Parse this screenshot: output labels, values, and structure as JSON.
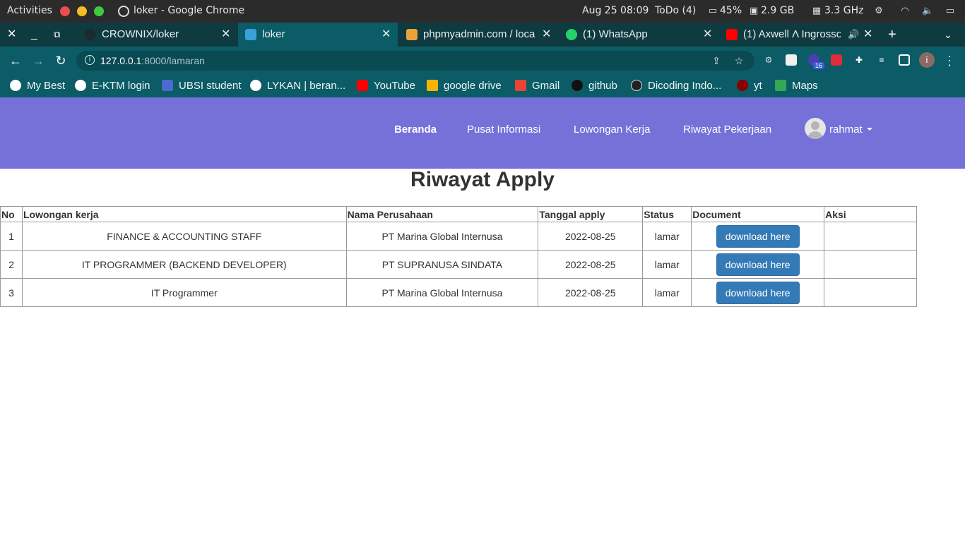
{
  "os_bar": {
    "activities": "Activities",
    "window_title": "loker - Google Chrome",
    "clock": "Aug 25  08:09",
    "todo": "ToDo (4)",
    "cpu": "45%",
    "memory": "2.9 GB",
    "frequency": "3.3 GHz"
  },
  "tabs": [
    {
      "label": "CROWNIX/loker",
      "icon": "github-icon",
      "active": false
    },
    {
      "label": "loker",
      "icon": "site-favicon",
      "active": true
    },
    {
      "label": "phpmyadmin.com / loca",
      "icon": "phpmyadmin-icon",
      "active": false
    },
    {
      "label": "(1) WhatsApp",
      "icon": "whatsapp-icon",
      "active": false
    },
    {
      "label": "(1) Axwell Λ Ingrosso",
      "icon": "youtube-icon",
      "active": false
    }
  ],
  "address": {
    "host": "127.0.0.1",
    "path": ":8000/lamaran"
  },
  "extensions": {
    "badge": "16"
  },
  "profile_initial": "i",
  "bookmarks": [
    {
      "label": "My Best",
      "color": "#ffffff"
    },
    {
      "label": "E-KTM login",
      "color": "#ffffff"
    },
    {
      "label": "UBSI student",
      "color": "#4a6bd1"
    },
    {
      "label": "LYKAN | beran...",
      "color": "#ffffff"
    },
    {
      "label": "YouTube",
      "color": "#ff0000"
    },
    {
      "label": "google drive",
      "color": "#f4b400"
    },
    {
      "label": "Gmail",
      "color": "#ea4335"
    },
    {
      "label": "github",
      "color": "#111111"
    },
    {
      "label": "Dicoding Indo...",
      "color": "#222222"
    },
    {
      "label": "yt",
      "color": "#8b0000"
    },
    {
      "label": "Maps",
      "color": "#34a853"
    }
  ],
  "navbar": {
    "links": [
      "Beranda",
      "Pusat Informasi",
      "Lowongan Kerja",
      "Riwayat Pekerjaan"
    ],
    "user": "rahmat",
    "bg": "#7571d9"
  },
  "page": {
    "title": "Riwayat Apply",
    "columns": [
      "No",
      "Lowongan kerja",
      "Nama Perusahaan",
      "Tanggal apply",
      "Status",
      "Document",
      "Aksi"
    ],
    "rows": [
      {
        "no": "1",
        "job": "FINANCE & ACCOUNTING STAFF",
        "company": "PT Marina Global Internusa",
        "date": "2022-08-25",
        "status": "lamar",
        "document": "download here",
        "action": ""
      },
      {
        "no": "2",
        "job": "IT PROGRAMMER (BACKEND DEVELOPER)",
        "company": "PT SUPRANUSA SINDATA",
        "date": "2022-08-25",
        "status": "lamar",
        "document": "download here",
        "action": ""
      },
      {
        "no": "3",
        "job": "IT Programmer",
        "company": "PT Marina Global Internusa",
        "date": "2022-08-25",
        "status": "lamar",
        "document": "download here",
        "action": ""
      }
    ]
  }
}
